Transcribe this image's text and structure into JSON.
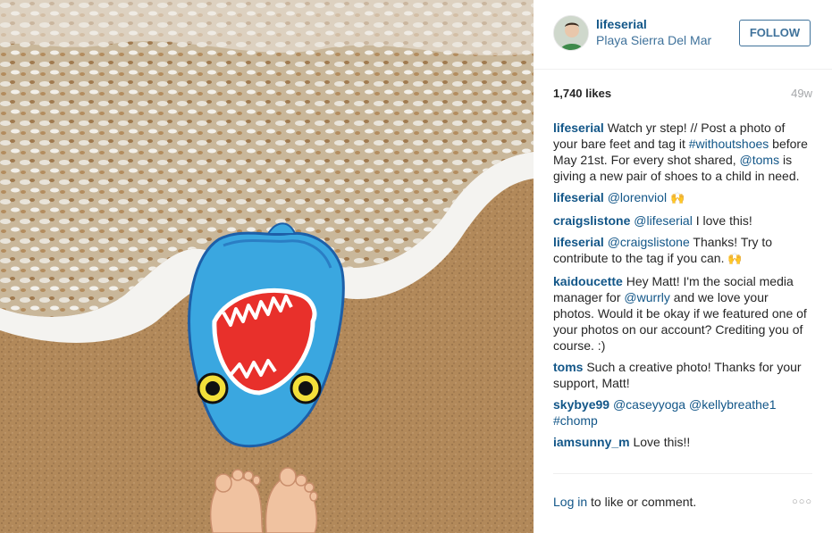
{
  "post": {
    "username": "lifeserial",
    "location": "Playa Sierra Del Mar",
    "follow_label": "FOLLOW",
    "likes": "1,740 likes",
    "age": "49w"
  },
  "caption": {
    "user": "lifeserial",
    "text_1": " Watch yr step! // Post a photo of your bare feet and tag it ",
    "tag": "#withoutshoes",
    "text_2": " before May 21st. For every shot shared, ",
    "mention": "@toms",
    "text_3": " is giving a new pair of shoes to a child in need."
  },
  "comments": [
    {
      "user": "lifeserial",
      "mention": "@lorenviol",
      "emoji": "🙌"
    },
    {
      "user": "craigslistone",
      "mention": "@lifeserial",
      "text": " I love this!"
    },
    {
      "user": "lifeserial",
      "mention": "@craigslistone",
      "text": " Thanks! Try to contribute to the tag if you can. ",
      "emoji": "🙌"
    },
    {
      "user": "kaidoucette",
      "text_1": " Hey Matt! I'm the social media manager for ",
      "mention": "@wurrly",
      "text_2": " and we love your photos. Would it be okay if we featured one of your photos on our account? Crediting you of course. :)"
    },
    {
      "user": "toms",
      "text": " Such a creative photo! Thanks for your support, Matt!"
    },
    {
      "user": "skybye99",
      "mention_1": "@caseyyoga",
      "mention_2": "@kellybreathe1",
      "tag": "#chomp"
    },
    {
      "user": "iamsunny_m",
      "text": " Love this!!"
    }
  ],
  "footer": {
    "login": "Log in",
    "rest": " to like or comment.",
    "more": "○○○"
  },
  "icons": {
    "more": "more-options-icon",
    "avatar": "avatar"
  },
  "colors": {
    "link": "#125688",
    "location": "#3f729b",
    "muted": "#a5a7aa",
    "sand": "#b08a5e",
    "shark": "#3aa7e0"
  }
}
